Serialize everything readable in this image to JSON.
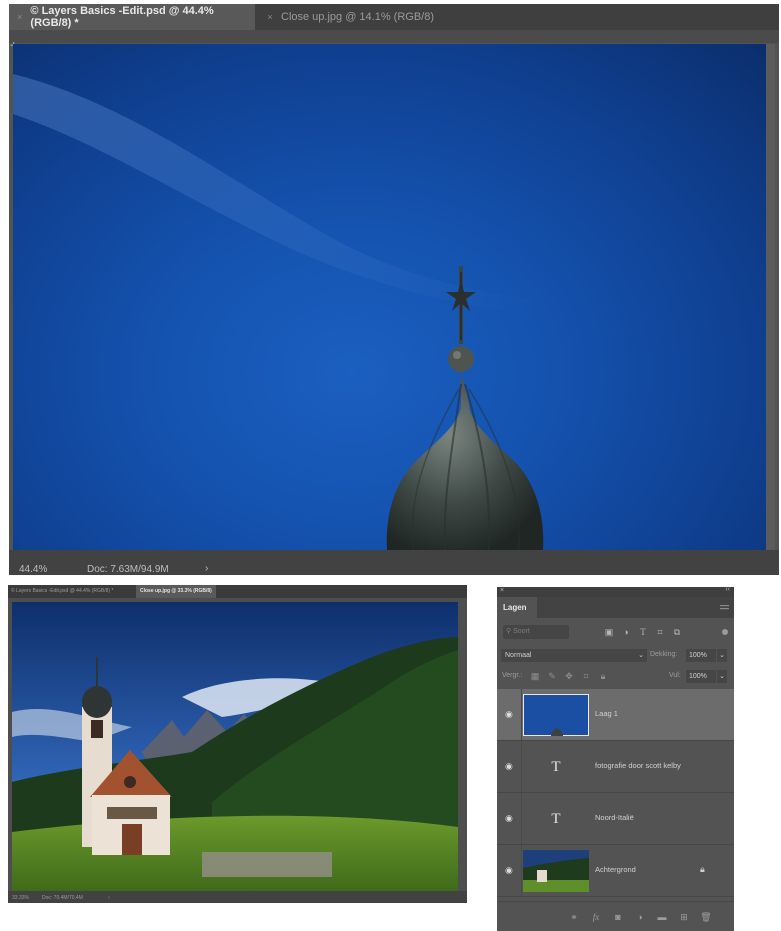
{
  "doc_window": {
    "tabs": [
      {
        "label": "© Layers Basics -Edit.psd @ 44.4% (RGB/8) *",
        "close": "×"
      },
      {
        "label": "Close up.jpg @ 14.1% (RGB/8)",
        "close": "×"
      }
    ],
    "status": {
      "zoom": "44.4%",
      "doc_size": "Doc: 7.63M/94.9M",
      "arrow": "›"
    }
  },
  "second_window": {
    "tabs": [
      {
        "label": "© Layers Basics -Edit.psd @ 44.4% (RGB/8) *"
      },
      {
        "label": "Close up.jpg @ 33.3% (RGB/8)"
      }
    ],
    "status": {
      "zoom": "33.33%",
      "doc_size": "Doc: 70.4M/70.4M",
      "arrow": "›"
    }
  },
  "layers_panel": {
    "close": "×",
    "collapse": "‹‹",
    "tab_label": "Lagen",
    "filter_placeholder": "Soort",
    "blend_mode": "Normaal",
    "opacity_label": "Dekking:",
    "opacity_value": "100%",
    "lock_label": "Vergr.:",
    "fill_label": "Vul:",
    "fill_value": "100%",
    "layers": [
      {
        "name": "Laag 1",
        "type": "image",
        "selected": true
      },
      {
        "name": "fotografie door scott kelby",
        "type": "text",
        "glyph": "T"
      },
      {
        "name": "Noord-Italië",
        "type": "text",
        "glyph": "T"
      },
      {
        "name": "Achtergrond",
        "type": "image",
        "locked": true
      }
    ]
  },
  "colors": {
    "app_bg": "#535353",
    "sky": "#1452ae",
    "panel_selected": "#6c6c6c"
  }
}
